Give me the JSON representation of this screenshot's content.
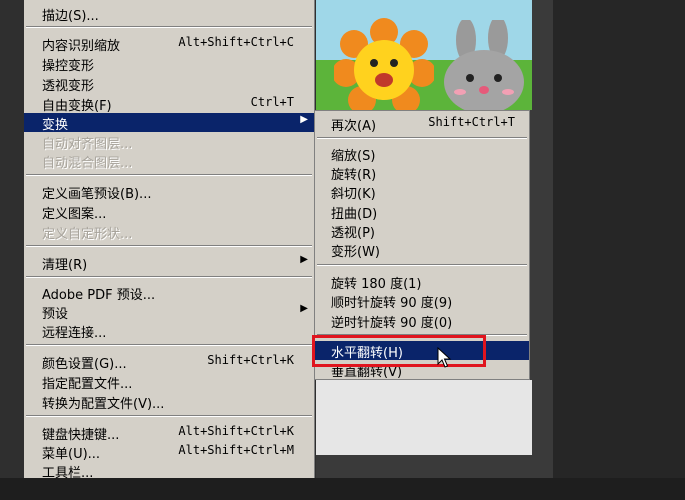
{
  "menu": {
    "items": [
      {
        "label": "描边(S)...",
        "shortcut": "",
        "disabled": false
      },
      {
        "label": "内容识别缩放",
        "shortcut": "Alt+Shift+Ctrl+C",
        "disabled": false
      },
      {
        "label": "操控变形",
        "shortcut": "",
        "disabled": false
      },
      {
        "label": "透视变形",
        "shortcut": "",
        "disabled": false
      },
      {
        "label": "自由变换(F)",
        "shortcut": "Ctrl+T",
        "disabled": false
      },
      {
        "label": "变换",
        "shortcut": "",
        "disabled": false,
        "submenu": true,
        "highlighted": true
      },
      {
        "label": "自动对齐图层...",
        "shortcut": "",
        "disabled": true
      },
      {
        "label": "自动混合图层...",
        "shortcut": "",
        "disabled": true
      },
      {
        "label": "定义画笔预设(B)...",
        "shortcut": "",
        "disabled": false
      },
      {
        "label": "定义图案...",
        "shortcut": "",
        "disabled": false
      },
      {
        "label": "定义自定形状...",
        "shortcut": "",
        "disabled": true
      },
      {
        "label": "清理(R)",
        "shortcut": "",
        "disabled": false,
        "submenu": true
      },
      {
        "label": "Adobe PDF 预设...",
        "shortcut": "",
        "disabled": false
      },
      {
        "label": "预设",
        "shortcut": "",
        "disabled": false,
        "submenu": true
      },
      {
        "label": "远程连接...",
        "shortcut": "",
        "disabled": false
      },
      {
        "label": "颜色设置(G)...",
        "shortcut": "Shift+Ctrl+K",
        "disabled": false
      },
      {
        "label": "指定配置文件...",
        "shortcut": "",
        "disabled": false
      },
      {
        "label": "转换为配置文件(V)...",
        "shortcut": "",
        "disabled": false
      },
      {
        "label": "键盘快捷键...",
        "shortcut": "Alt+Shift+Ctrl+K",
        "disabled": false
      },
      {
        "label": "菜单(U)...",
        "shortcut": "Alt+Shift+Ctrl+M",
        "disabled": false
      },
      {
        "label": "工具栏...",
        "shortcut": "",
        "disabled": false
      }
    ]
  },
  "submenu": {
    "items": [
      {
        "label": "再次(A)",
        "shortcut": "Shift+Ctrl+T"
      },
      {
        "label": "缩放(S)",
        "shortcut": ""
      },
      {
        "label": "旋转(R)",
        "shortcut": ""
      },
      {
        "label": "斜切(K)",
        "shortcut": ""
      },
      {
        "label": "扭曲(D)",
        "shortcut": ""
      },
      {
        "label": "透视(P)",
        "shortcut": ""
      },
      {
        "label": "变形(W)",
        "shortcut": ""
      },
      {
        "label": "旋转 180 度(1)",
        "shortcut": ""
      },
      {
        "label": "顺时针旋转 90 度(9)",
        "shortcut": ""
      },
      {
        "label": "逆时针旋转 90 度(0)",
        "shortcut": ""
      },
      {
        "label": "水平翻转(H)",
        "shortcut": "",
        "highlighted": true
      },
      {
        "label": "垂直翻转(V)",
        "shortcut": ""
      }
    ]
  },
  "colors": {
    "menu_bg": "#d4d0c8",
    "highlight": "#0a246a",
    "annotation_box": "#e0141e"
  }
}
